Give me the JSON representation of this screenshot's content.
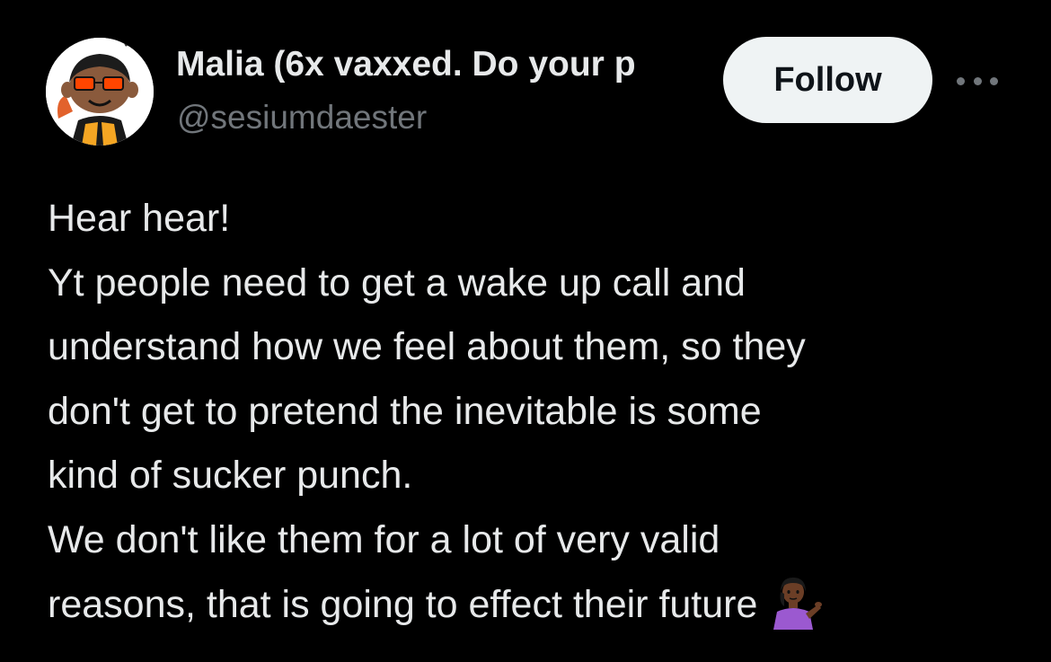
{
  "author": {
    "display_name": "Malia (6x vaxxed. Do your p",
    "handle": "@sesiumdaester",
    "avatar_icon": "cartoon-avatar-icon"
  },
  "actions": {
    "follow_label": "Follow",
    "more_icon": "more-options-icon"
  },
  "tweet": {
    "lines": [
      "Hear hear!",
      "Yt people need to get a wake up call and",
      "understand how we feel about them, so they",
      "don't get to pretend the inevitable is some",
      "kind of sucker punch.",
      "We don't like them for a lot of very valid",
      "reasons, that is going to effect their future"
    ],
    "emoji_icon": "person-tipping-hand-emoji"
  },
  "colors": {
    "background": "#000000",
    "text_primary": "#e7e9ea",
    "text_secondary": "#71767b",
    "follow_button_bg": "#eff3f4",
    "follow_button_text": "#0f1419"
  }
}
